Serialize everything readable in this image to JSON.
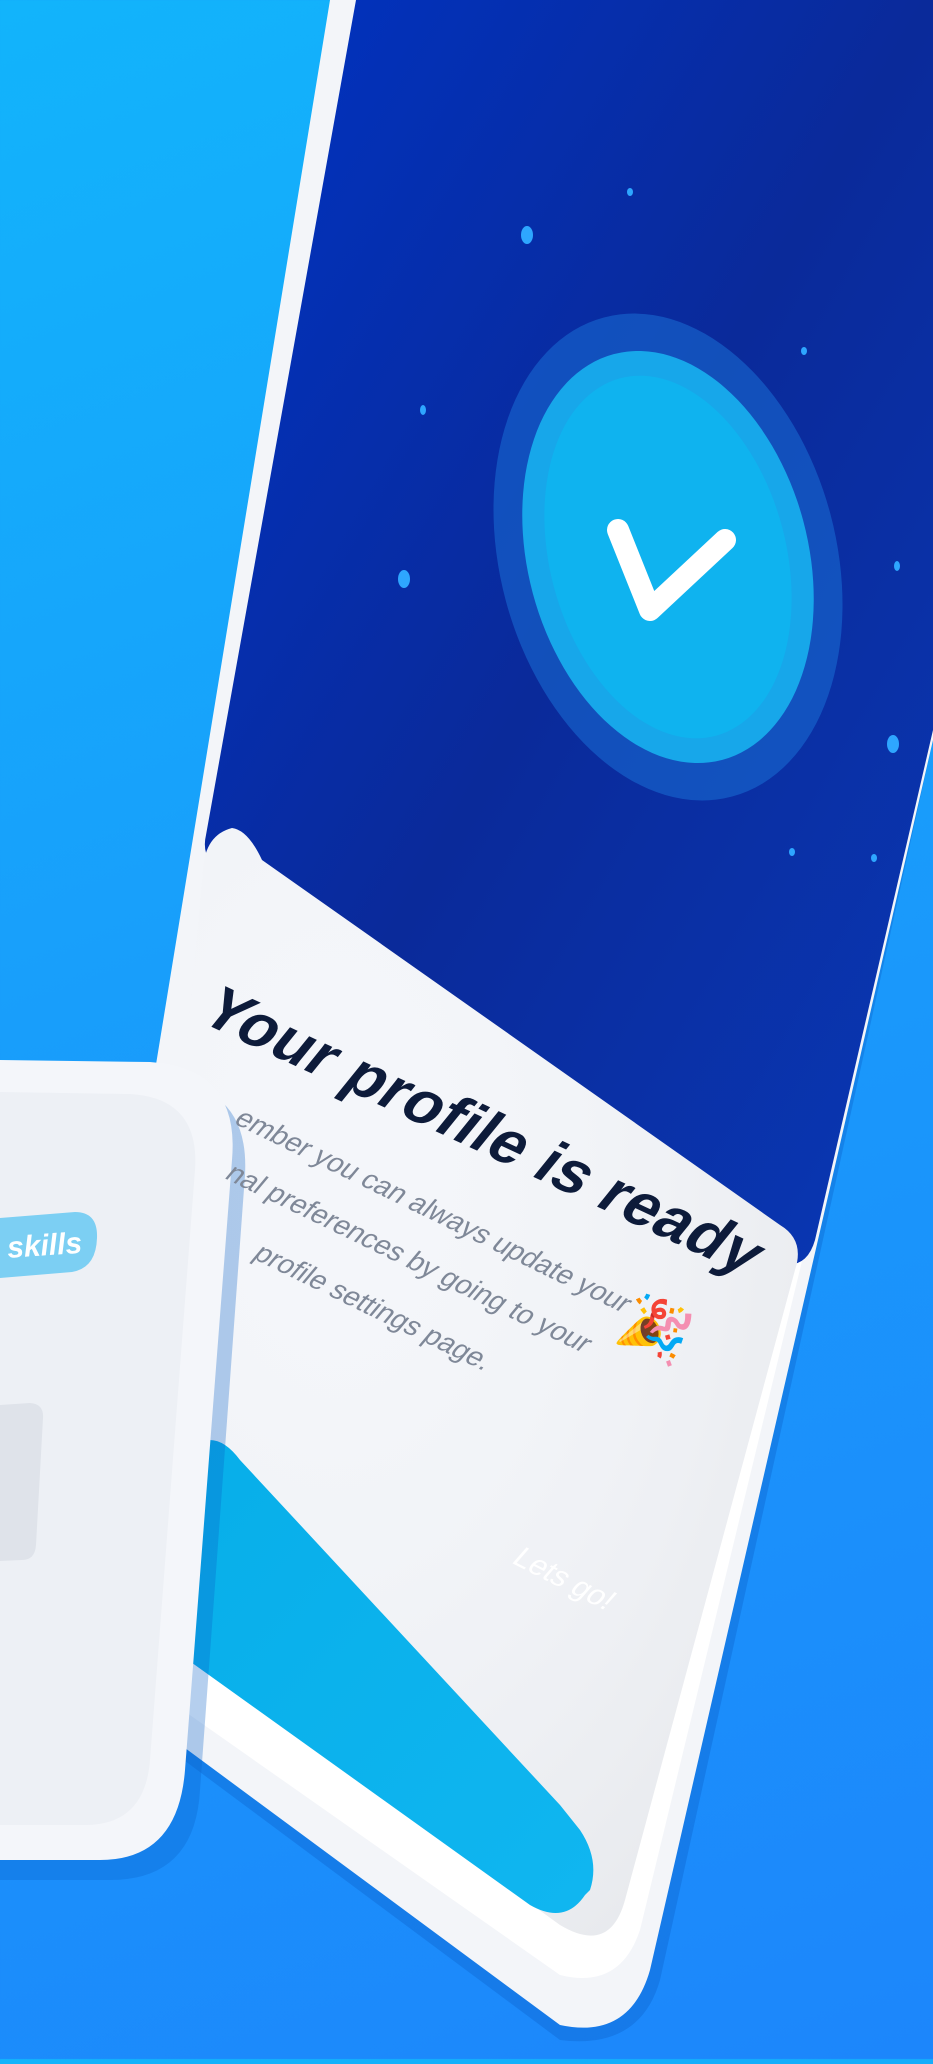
{
  "screen": {
    "title": "Your profile is ready",
    "title_emoji": "🎉",
    "message_lines": [
      "ember you can always update your",
      "nal preferences by going to your",
      "profile settings page."
    ],
    "cta_label": "Lets go!"
  },
  "secondary_screen": {
    "chip_label": "skills"
  },
  "icons": {
    "success": "check-circle-icon",
    "decoration": "star-dot-icon"
  },
  "colors": {
    "background": "#1a98fb",
    "hero_dark": "#0a2a9a",
    "hero_light": "#0040c8",
    "check_outer": "#1a8fe6",
    "check_inner": "#0db0ee",
    "cta": "#0db0ee",
    "chip": "#7ccff3",
    "title": "#0d1b3a",
    "body": "#7f8898"
  }
}
